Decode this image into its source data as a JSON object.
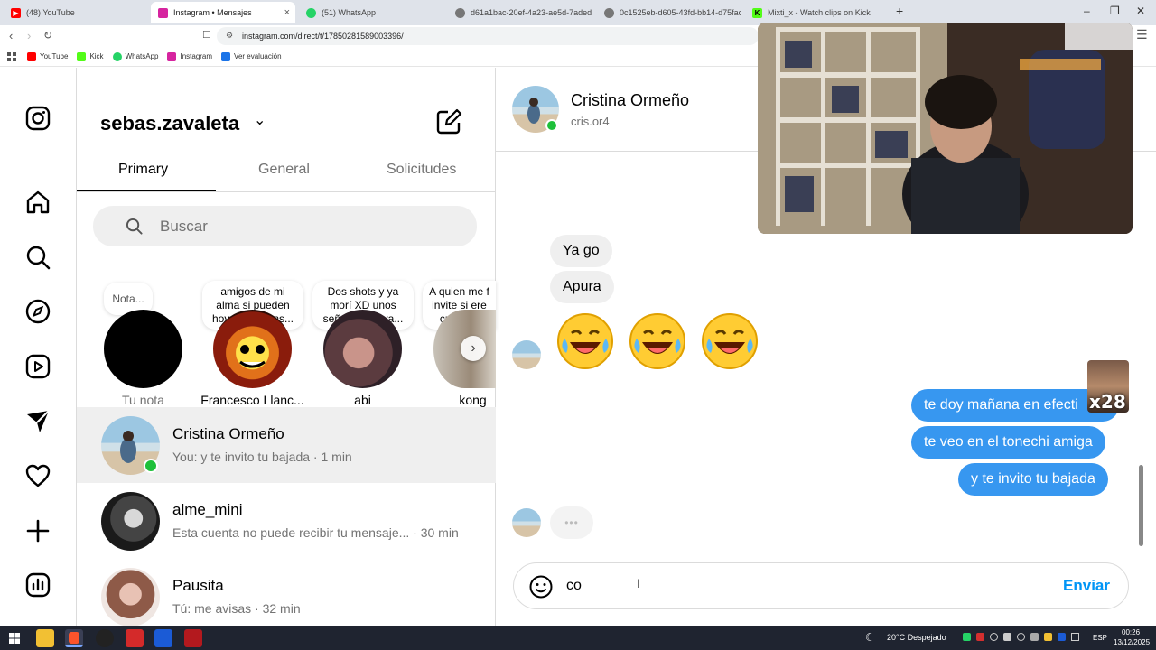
{
  "browser": {
    "tabs": [
      {
        "label": "(48) YouTube",
        "color": "#ff0000"
      },
      {
        "label": "Instagram • Mensajes",
        "color": "#d6249f",
        "active": true
      },
      {
        "label": "(51) WhatsApp",
        "color": "#25d366"
      },
      {
        "label": "d61a1bac-20ef-4a23-ae5d-7aded2d",
        "color": "#666666"
      },
      {
        "label": "0c1525eb-d605-43fd-bb14-d75fac7b",
        "color": "#666666"
      },
      {
        "label": "Mixti_x - Watch clips on Kick",
        "color": "#53fc18"
      }
    ],
    "new_tab": "+",
    "close_tab": "×",
    "window_buttons": [
      "–",
      "❐",
      "✕"
    ],
    "url": "instagram.com/direct/t/17850281589003396/",
    "bookmarks": [
      {
        "label": "YouTube",
        "color": "#ff0000"
      },
      {
        "label": "Kick",
        "color": "#53fc18"
      },
      {
        "label": "WhatsApp",
        "color": "#25d366"
      },
      {
        "label": "Instagram",
        "color": "#d6249f"
      },
      {
        "label": "Ver evaluación",
        "color": "#1a73e8"
      }
    ]
  },
  "sidebar": {
    "icons": [
      "instagram-logo-icon",
      "home-icon",
      "search-icon",
      "explore-icon",
      "reels-icon",
      "messages-icon",
      "notifications-icon",
      "create-icon",
      "dashboard-icon"
    ]
  },
  "inbox": {
    "username": "sebas.zavaleta",
    "tabs": [
      "Primary",
      "General",
      "Solicitudes"
    ],
    "search_placeholder": "Buscar",
    "notes": [
      {
        "note": "Nota...",
        "name": "Tu nota"
      },
      {
        "note": "amigos de mi alma si pueden hoy suscribans...",
        "name": "Francesco Llanc..."
      },
      {
        "note": "Dos shots y ya morí XD unos señores me va...",
        "name": "abi"
      },
      {
        "note": "A quien me f invite si ere creador.",
        "name": "kong"
      }
    ],
    "conversations": [
      {
        "name": "Cristina Ormeño",
        "preview": "You: y te invito tu bajada · 1 min",
        "online": true,
        "selected": true
      },
      {
        "name": "alme_mini",
        "preview": "Esta cuenta no puede recibir tu mensaje... · 30 min"
      },
      {
        "name": "Pausita",
        "preview": "Tú: me avisas · 32 min"
      }
    ]
  },
  "chat": {
    "contact_name": "Cristina Ormeño",
    "contact_username": "cris.or4",
    "incoming": [
      "Ya go",
      "Apura"
    ],
    "emoji_count": 3,
    "outgoing": [
      "te doy mañana en efecti",
      "te veo en el tonechi amiga",
      "y te invito tu bajada"
    ],
    "typing_indicator": "•••",
    "composer_text": "co",
    "send_label": "Enviar",
    "overlay_badge": "x28"
  },
  "taskbar": {
    "weather": "20°C  Despejado",
    "lang": "ESP",
    "time": "00:26",
    "date": "13/12/2025"
  },
  "colors": {
    "accent_blue": "#3797f0",
    "send_blue": "#0095f6",
    "online_green": "#1ec03a"
  }
}
